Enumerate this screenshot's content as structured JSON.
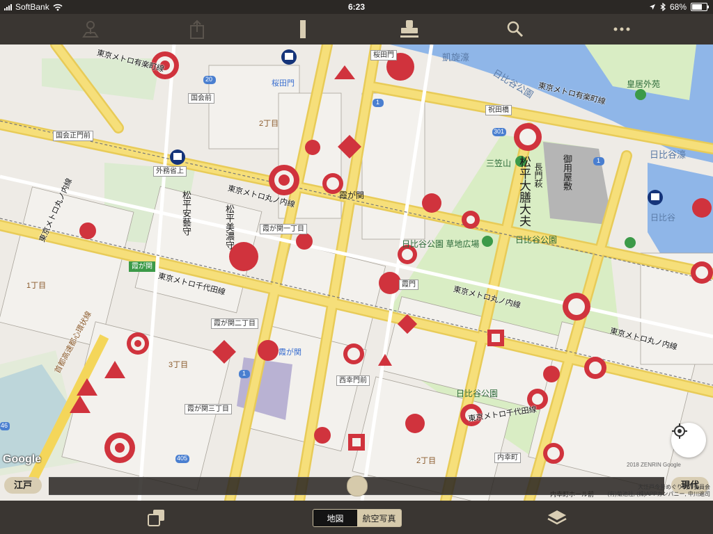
{
  "status_bar": {
    "carrier": "SoftBank",
    "time": "6:23",
    "battery": "68%"
  },
  "toolbar": {
    "icons": [
      "person-pin-icon",
      "share-icon",
      "brush-icon",
      "stamp-icon",
      "search-icon",
      "more-icon"
    ]
  },
  "map": {
    "areas": [
      "2丁目",
      "1丁目",
      "3丁目",
      "2丁目"
    ],
    "landmarks": [
      "桜田門",
      "国会前",
      "国会正門前",
      "外務省上",
      "霞が関",
      "霞が関一丁目",
      "霞が関二丁目",
      "霞が関三丁目",
      "霞門",
      "西幸門前",
      "祝田橋",
      "内幸町",
      "内幸町ホール前"
    ],
    "metro_lines": [
      "東京メトロ有楽町線",
      "東京メトロ有楽町線",
      "東京メトロ丸ノ内線",
      "東京メトロ丸ノ内線",
      "東京メトロ丸ノ内線",
      "東京メトロ丸ノ内線",
      "東京メトロ千代田線",
      "東京メトロ千代田線"
    ],
    "parks": [
      "日比谷公園",
      "日比谷公園 草地広場",
      "日比谷公園",
      "三笠山",
      "皇居外苑",
      "日比谷"
    ],
    "water": [
      "凱旋濠",
      "日比谷濠",
      "日比谷公園"
    ],
    "highway": "首都高速都心環状線",
    "place_labels": [
      "霞が関",
      "霞が関"
    ],
    "road_numbers": [
      "20",
      "1",
      "301",
      "1",
      "405",
      "1",
      "405",
      "46"
    ],
    "edo_texts": [
      "松平大膳大夫",
      "長門萩",
      "御用屋敷",
      "松平安藝守",
      "松平美濃守"
    ],
    "google": "Google",
    "map_badge": "2018 ZENRIN Google"
  },
  "slider": {
    "left_label": "江戸",
    "right_label": "現代",
    "position": 0.5
  },
  "credits": [
    "大江戸今昔めぐり制作委員会",
    "(有)菊池社, (株)APPカンパニー, 中川遍司"
  ],
  "bottom_bar": {
    "segment_map": "地図",
    "segment_aerial": "航空写真",
    "selected": "地図"
  },
  "colors": {
    "bar": "#3a3632",
    "crest": "#d0333d",
    "road": "#f6df7a",
    "park": "#d9edc4",
    "water": "#8fb6e8"
  }
}
